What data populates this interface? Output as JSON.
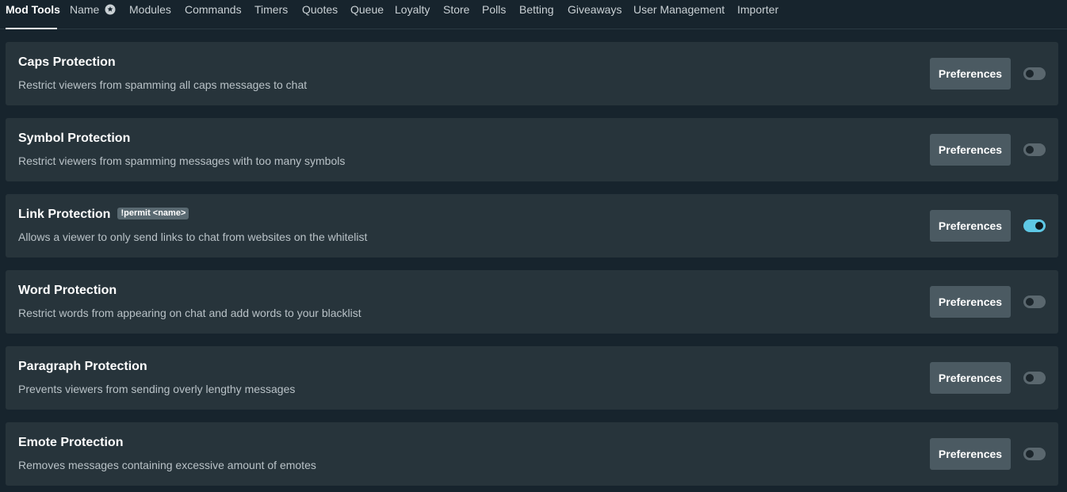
{
  "tabs": [
    {
      "label": "Mod Tools",
      "active": true
    },
    {
      "label": "Name",
      "icon": "gear-icon"
    },
    {
      "label": "Modules"
    },
    {
      "label": "Commands"
    },
    {
      "label": "Timers"
    },
    {
      "label": "Quotes"
    },
    {
      "label": "Queue"
    },
    {
      "label": "Loyalty"
    },
    {
      "label": "Store"
    },
    {
      "label": "Polls"
    },
    {
      "label": "Betting"
    },
    {
      "label": "Giveaways"
    },
    {
      "label": "User Management"
    },
    {
      "label": "Importer"
    }
  ],
  "modules": [
    {
      "title": "Caps Protection",
      "description": "Restrict viewers from spamming all caps messages to chat",
      "button": "Preferences",
      "enabled": false
    },
    {
      "title": "Symbol Protection",
      "description": "Restrict viewers from spamming messages with too many symbols",
      "button": "Preferences",
      "enabled": false
    },
    {
      "title": "Link Protection",
      "badge": "!permit <name>",
      "description": "Allows a viewer to only send links to chat from websites on the whitelist",
      "button": "Preferences",
      "enabled": true
    },
    {
      "title": "Word Protection",
      "description": "Restrict words from appearing on chat and add words to your blacklist",
      "button": "Preferences",
      "enabled": false
    },
    {
      "title": "Paragraph Protection",
      "description": "Prevents viewers from sending overly lengthy messages",
      "button": "Preferences",
      "enabled": false
    },
    {
      "title": "Emote Protection",
      "description": "Removes messages containing excessive amount of emotes",
      "button": "Preferences",
      "enabled": false
    }
  ],
  "colors": {
    "background": "#17242d",
    "card": "#27343b",
    "button": "#4b5a62",
    "toggle_on": "#5ec8e5",
    "toggle_off": "#5a676e"
  }
}
